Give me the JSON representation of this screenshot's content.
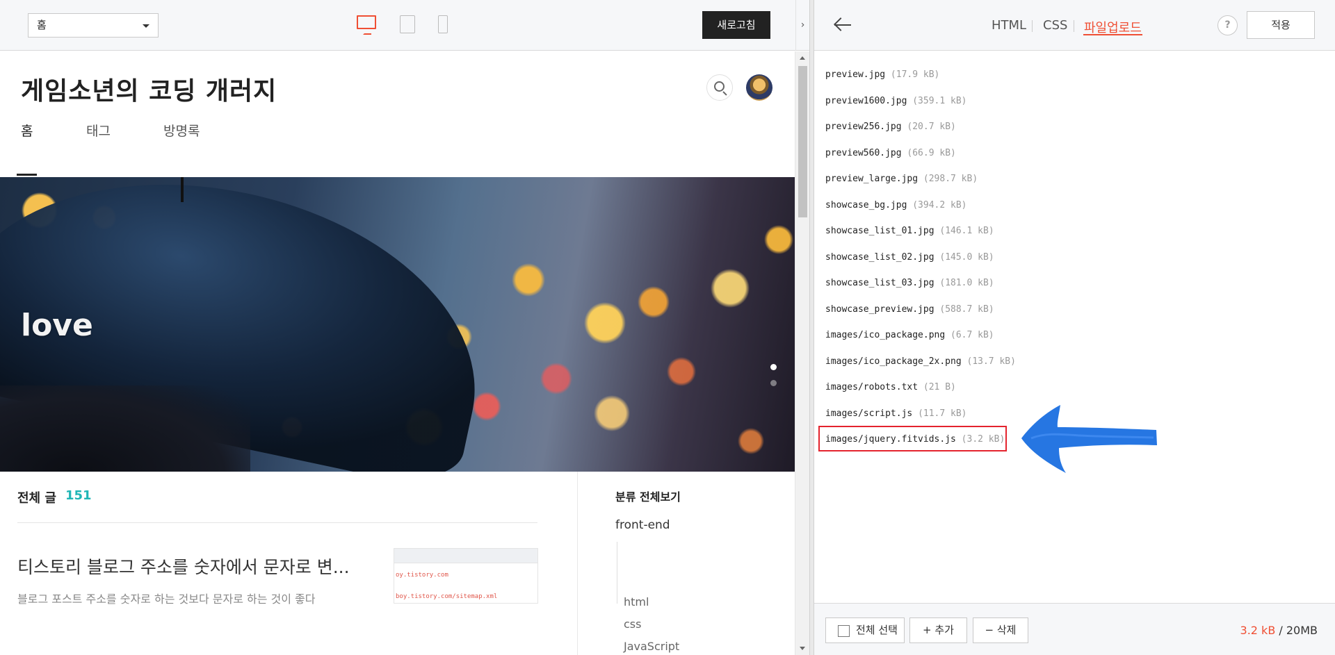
{
  "preview": {
    "page_select": "홈",
    "refresh_label": "새로고침",
    "collapse_glyph": "›",
    "blog_title": "게임소년의 코딩 개러지",
    "nav": [
      "홈",
      "태그",
      "방명록"
    ],
    "hero_text": "love",
    "total_label": "전체 글",
    "total_count": "151",
    "post_title": "티스토리 블로그 주소를 숫자에서 문자로 변...",
    "post_summary": "블로그 포스트 주소를 숫자로 하는 것보다 문자로 하는 것이 좋다",
    "thumb_line1": "oy.tistory.com",
    "thumb_line2": "boy.tistory.com/sitemap.xml",
    "category_title": "분류 전체보기",
    "category_main": "front-end",
    "category_subs": [
      "html",
      "css",
      "JavaScript"
    ]
  },
  "editor": {
    "tabs": [
      "HTML",
      "CSS",
      "파일업로드"
    ],
    "active_tab": "파일업로드",
    "help_label": "?",
    "apply_label": "적용",
    "files": [
      {
        "name": "preview.jpg",
        "size": "(17.9 kB)"
      },
      {
        "name": "preview1600.jpg",
        "size": "(359.1 kB)"
      },
      {
        "name": "preview256.jpg",
        "size": "(20.7 kB)"
      },
      {
        "name": "preview560.jpg",
        "size": "(66.9 kB)"
      },
      {
        "name": "preview_large.jpg",
        "size": "(298.7 kB)"
      },
      {
        "name": "showcase_bg.jpg",
        "size": "(394.2 kB)"
      },
      {
        "name": "showcase_list_01.jpg",
        "size": "(146.1 kB)"
      },
      {
        "name": "showcase_list_02.jpg",
        "size": "(145.0 kB)"
      },
      {
        "name": "showcase_list_03.jpg",
        "size": "(181.0 kB)"
      },
      {
        "name": "showcase_preview.jpg",
        "size": "(588.7 kB)"
      },
      {
        "name": "images/ico_package.png",
        "size": "(6.7 kB)"
      },
      {
        "name": "images/ico_package_2x.png",
        "size": "(13.7 kB)"
      },
      {
        "name": "images/robots.txt",
        "size": "(21 B)"
      },
      {
        "name": "images/script.js",
        "size": "(11.7 kB)"
      },
      {
        "name": "images/jquery.fitvids.js",
        "size": "(3.2 kB)"
      }
    ],
    "select_all_label": "전체 선택",
    "add_label": "+ 추가",
    "delete_label": "− 삭제",
    "usage_used": "3.2 kB",
    "usage_sep": " / ",
    "usage_total": "20MB"
  },
  "colors": {
    "accent": "#ef4f34",
    "highlight_box": "#e4232d",
    "annotation_arrow": "#1a6fe0",
    "count_teal": "#20b6b6"
  }
}
